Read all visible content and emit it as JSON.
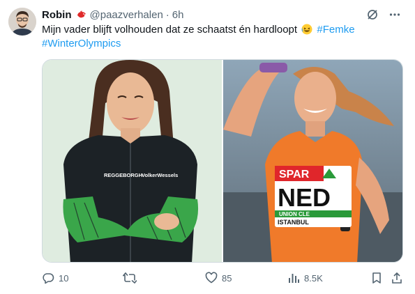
{
  "author": {
    "display_name": "Robin",
    "handle": "@paazverhalen",
    "separator": "·",
    "time": "6h"
  },
  "tweet": {
    "text": "Mijn vader blijft volhouden dat ze schaatst én hardloopt",
    "hashtag_1": "#Femke",
    "hashtag_2": "#WinterOlympics"
  },
  "media": {
    "left_image": {
      "suit_text_1": "REGGEBORGH",
      "suit_text_2": "VolkerWessels"
    },
    "right_image": {
      "bib_brand": "SPAR",
      "bib_country": "NED",
      "bib_sub": "UNION CLE",
      "bib_city": "ISTANBUL"
    }
  },
  "actions": {
    "reply_count": "10",
    "retweet_count": "",
    "like_count": "85",
    "view_count": "8.5K"
  },
  "colors": {
    "link": "#1d9bf0",
    "secondary_text": "#536471",
    "orange_kit": "#f07a2a",
    "green_sleeve": "#3aa64a"
  },
  "icons": [
    "grok-icon",
    "more-icon",
    "reply-icon",
    "retweet-icon",
    "like-icon",
    "views-icon",
    "bookmark-icon",
    "share-icon"
  ]
}
